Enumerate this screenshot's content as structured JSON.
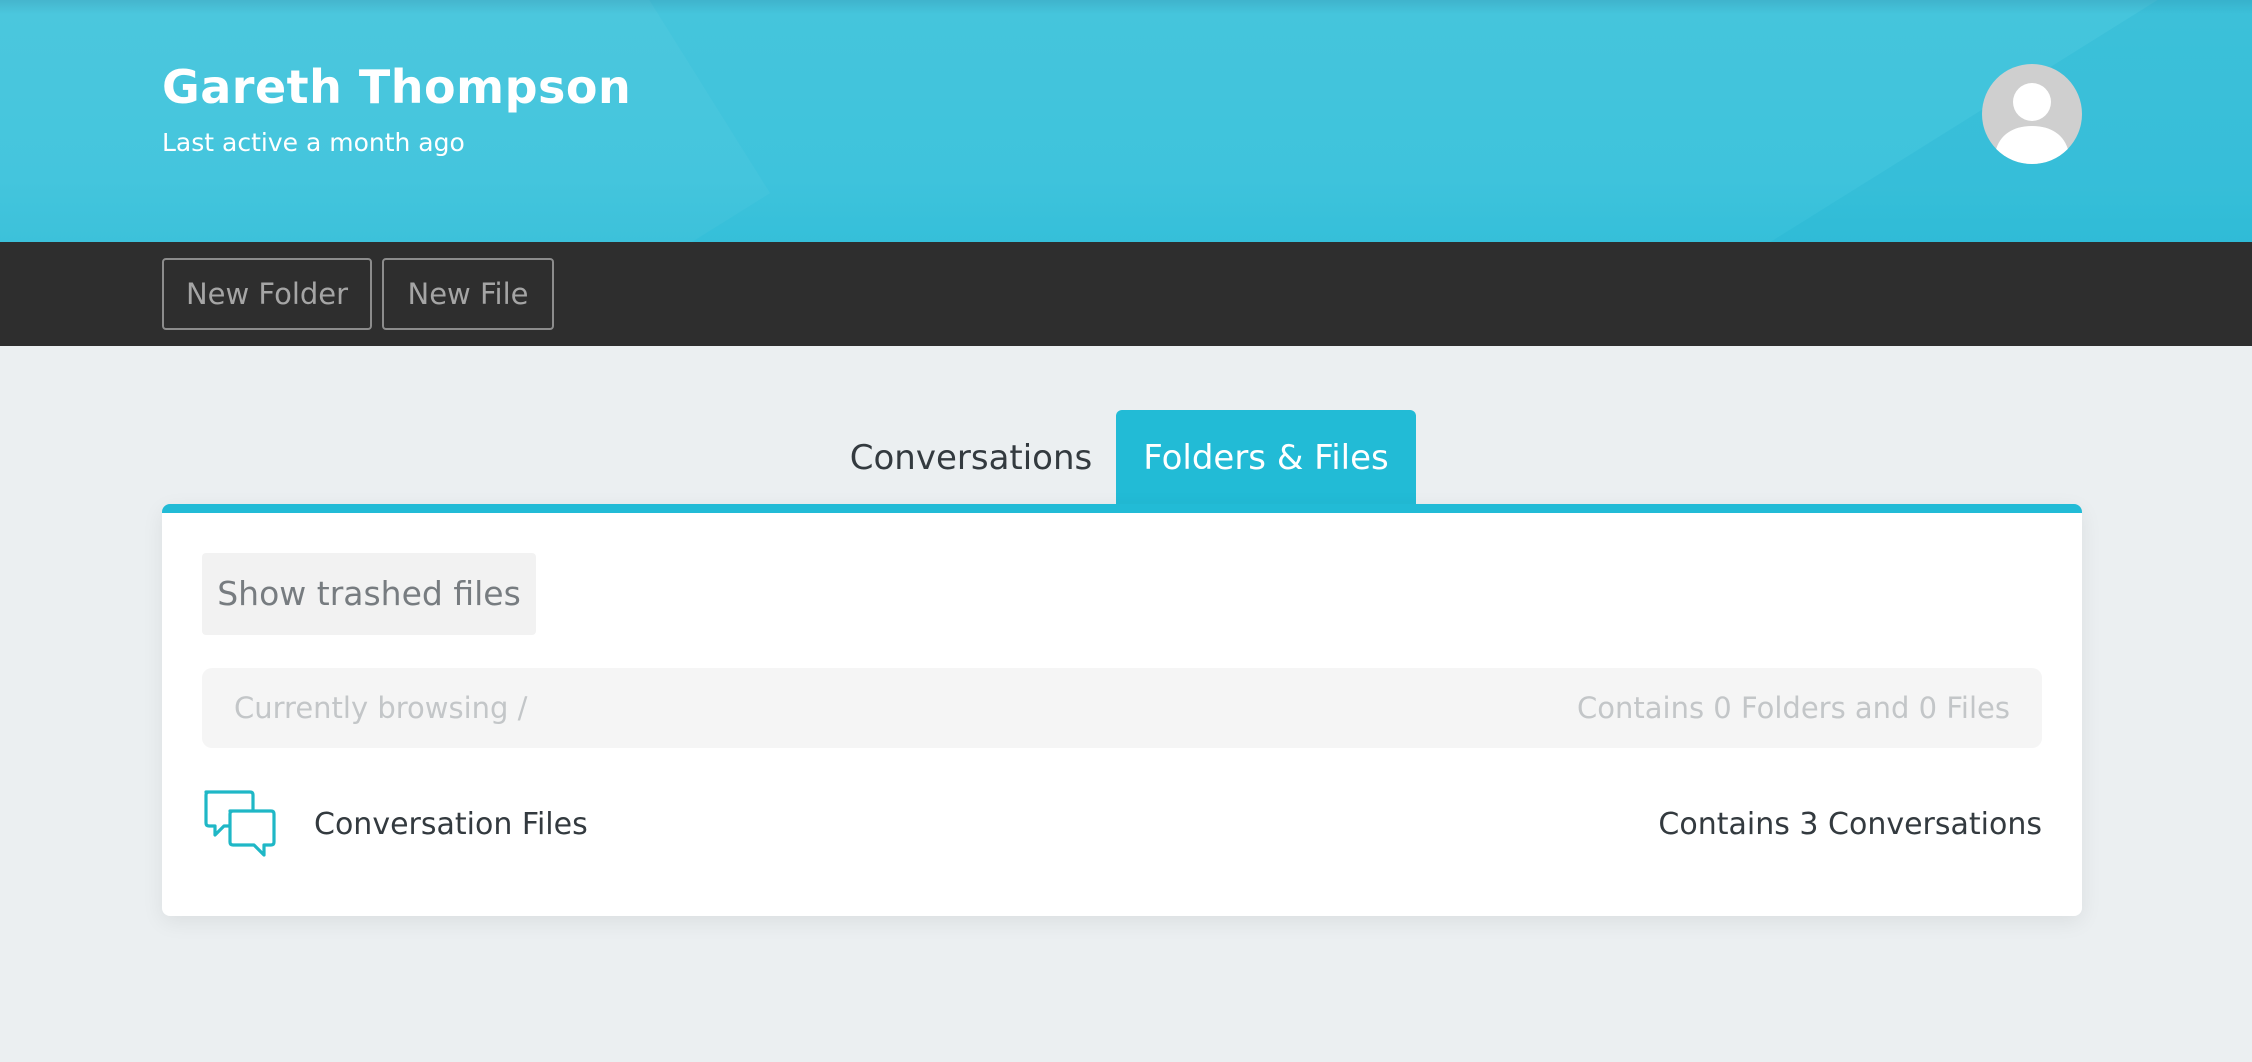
{
  "profile": {
    "name": "Gareth Thompson",
    "last_active": "Last active a month ago",
    "avatar_icon": "user-avatar-icon"
  },
  "toolbar": {
    "new_folder_label": "New Folder",
    "new_file_label": "New File"
  },
  "tabs": [
    {
      "label": "Conversations",
      "active": false
    },
    {
      "label": "Folders & Files",
      "active": true
    }
  ],
  "panel": {
    "trash_button_label": "Show trashed files",
    "browse": {
      "path_label": "Currently browsing /",
      "summary": "Contains 0 Folders and 0 Files"
    },
    "items": [
      {
        "icon": "chat-bubbles-icon",
        "name": "Conversation Files",
        "summary": "Contains 3 Conversations"
      }
    ]
  },
  "colors": {
    "header": "#3ec3dc",
    "accent": "#22bbd6",
    "toolbar": "#2e2e2e",
    "background": "#ebeff1",
    "icon": "#1fb7c6"
  }
}
